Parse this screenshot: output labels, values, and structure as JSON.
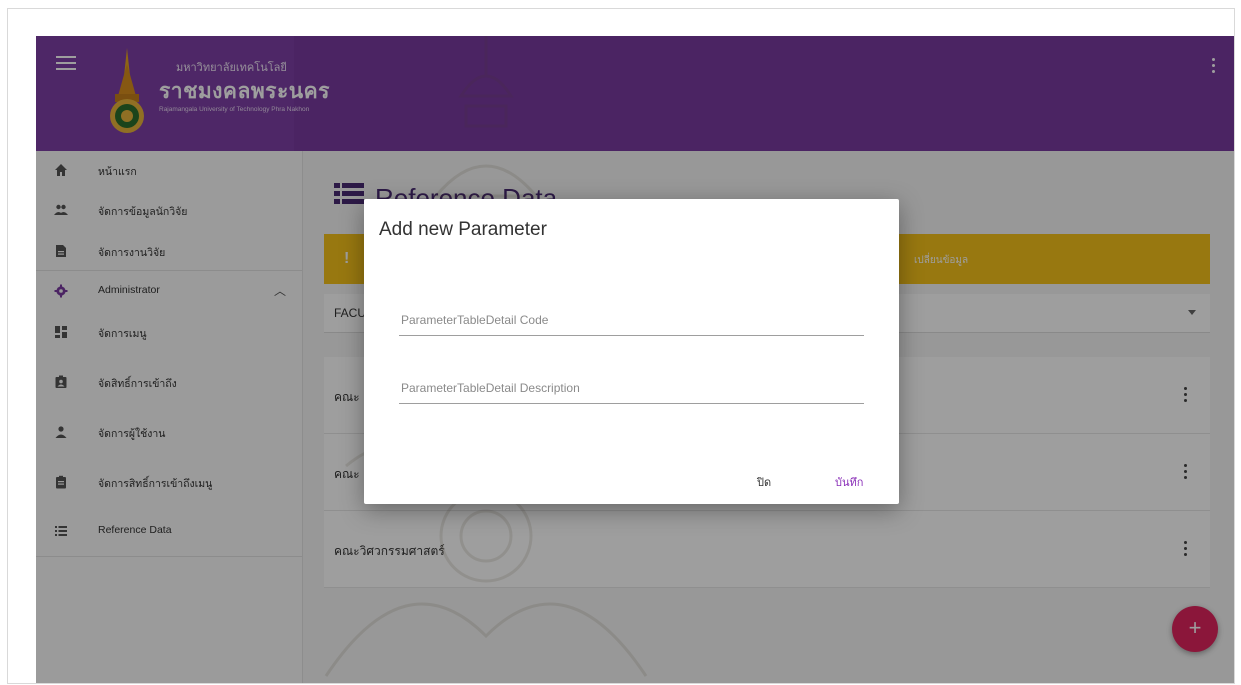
{
  "header": {
    "university_th_small": "มหาวิทยาลัยเทคโนโลยี",
    "university_th_big": "ราชมงคลพระนคร",
    "university_en": "Rajamangala University of Technology Phra Nakhon",
    "color": "#7a3aa1"
  },
  "sidebar": {
    "items": [
      {
        "label": "หน้าแรก",
        "icon": "home-icon"
      },
      {
        "label": "จัดการข้อมูลนักวิจัย",
        "icon": "people-icon"
      },
      {
        "label": "จัดการงานวิจัย",
        "icon": "document-icon"
      },
      {
        "label": "Administrator",
        "icon": "gear-icon"
      },
      {
        "label": "จัดการเมนู",
        "icon": "dashboard-icon"
      },
      {
        "label": "จัดสิทธิ์การเข้าถึง",
        "icon": "badge-icon"
      },
      {
        "label": "จัดการผู้ใช้งาน",
        "icon": "person-icon"
      },
      {
        "label": "จัดการสิทธิ์การเข้าถึงเมนู",
        "icon": "clipboard-icon"
      },
      {
        "label": "Reference Data",
        "icon": "list-icon"
      }
    ]
  },
  "main": {
    "title": "Reference Data",
    "alert_text": "เปลี่ยนข้อมูล",
    "select_value": "FACU",
    "list": [
      {
        "label": "คณะ"
      },
      {
        "label": "คณะ"
      },
      {
        "label": "คณะวิศวกรรมศาสตร์"
      }
    ],
    "fab_label": "+"
  },
  "dialog": {
    "title": "Add new Parameter",
    "code_placeholder": "ParameterTableDetail Code",
    "description_placeholder": "ParameterTableDetail Description",
    "close_label": "ปิด",
    "save_label": "บันทึก"
  },
  "colors": {
    "accent": "#8a2fb8",
    "alert": "#f5c21a",
    "fab": "#e0245e"
  }
}
